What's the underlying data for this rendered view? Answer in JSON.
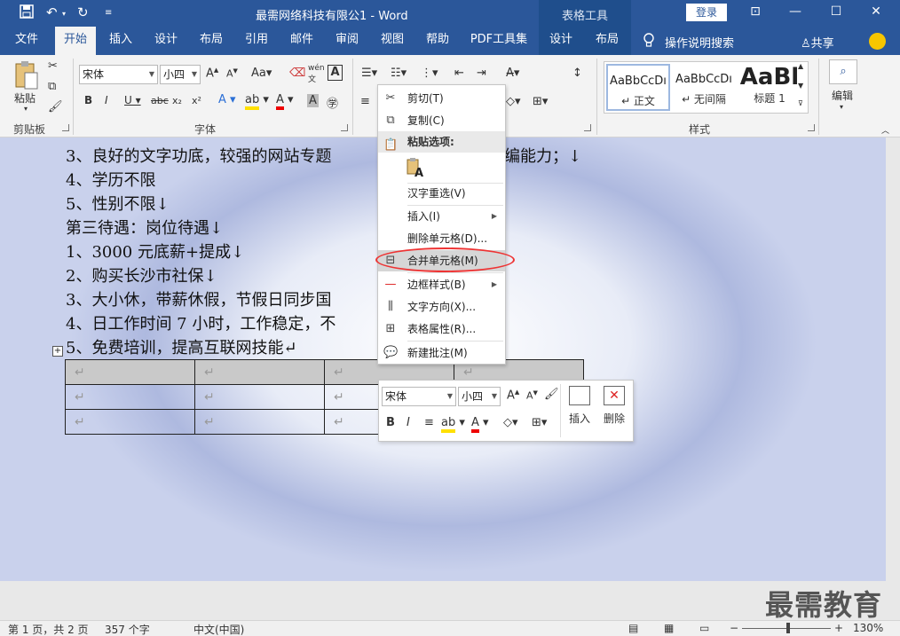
{
  "titlebar": {
    "doc_title": "最需网络科技有限公1 - Word",
    "context_group": "表格工具",
    "login_label": "登录",
    "qa_icons": [
      "save-icon",
      "undo-icon",
      "redo-icon",
      "customize-icon"
    ]
  },
  "tabs": [
    {
      "label": "文件"
    },
    {
      "label": "开始"
    },
    {
      "label": "插入"
    },
    {
      "label": "设计"
    },
    {
      "label": "布局"
    },
    {
      "label": "引用"
    },
    {
      "label": "邮件"
    },
    {
      "label": "审阅"
    },
    {
      "label": "视图"
    },
    {
      "label": "帮助"
    },
    {
      "label": "PDF工具集"
    },
    {
      "label": "设计"
    },
    {
      "label": "布局"
    }
  ],
  "tell_me": "操作说明搜索",
  "share": "共享",
  "ribbon": {
    "clipboard_label": "剪贴板",
    "paste_label": "粘贴",
    "font_label": "字体",
    "font_name": "宋体",
    "font_size": "小四",
    "styles_label": "样式",
    "edit_label": "编辑",
    "styles": [
      {
        "sample": "AaBbCcDı",
        "name": "↵ 正文"
      },
      {
        "sample": "AaBbCcDı",
        "name": "↵ 无间隔"
      },
      {
        "sample": "AaBl",
        "name": "标题 1"
      }
    ]
  },
  "document": {
    "lines": [
      "3、良好的文字功底，较强的网站专题",
      "4、学历不限",
      "5、性别不限↓",
      "第三待遇：岗位待遇↓",
      "1、3000 元底薪+提成↓",
      "2、购买长沙市社保↓",
      "3、大小休，带薪休假，节假日同步国",
      "4、日工作时间 7 小时，工作稳定，不",
      "5、免费培训，提高互联网技能↵"
    ],
    "line1_tail": "编能力；↓",
    "cell_mark": "↵"
  },
  "context_menu": {
    "items": [
      {
        "icon": "scissors-icon",
        "label": "剪切(T)"
      },
      {
        "icon": "copy-icon",
        "label": "复制(C)"
      },
      {
        "label": "粘贴选项:"
      },
      {
        "icon": "paste-text-icon",
        "label": ""
      },
      {
        "label": "汉字重选(V)"
      },
      {
        "label": "插入(I)"
      },
      {
        "label": "删除单元格(D)..."
      },
      {
        "icon": "merge-cells-icon",
        "label": "合并单元格(M)"
      },
      {
        "icon": "border-style-icon",
        "label": "边框样式(B)"
      },
      {
        "icon": "text-direction-icon",
        "label": "文字方向(X)..."
      },
      {
        "icon": "table-properties-icon",
        "label": "表格属性(R)..."
      },
      {
        "icon": "new-comment-icon",
        "label": "新建批注(M)"
      }
    ]
  },
  "mini_toolbar": {
    "font_name": "宋体",
    "font_size": "小四",
    "insert_label": "插入",
    "delete_label": "删除"
  },
  "statusbar": {
    "page": "第 1 页，共 2 页",
    "words": "357 个字",
    "language": "中文(中国)",
    "zoom": "130%"
  },
  "watermark": "最需教育",
  "colors": {
    "brand": "#2b579a",
    "highlight_ring": "#e33333",
    "table_header_fill": "#c9c9c9"
  }
}
